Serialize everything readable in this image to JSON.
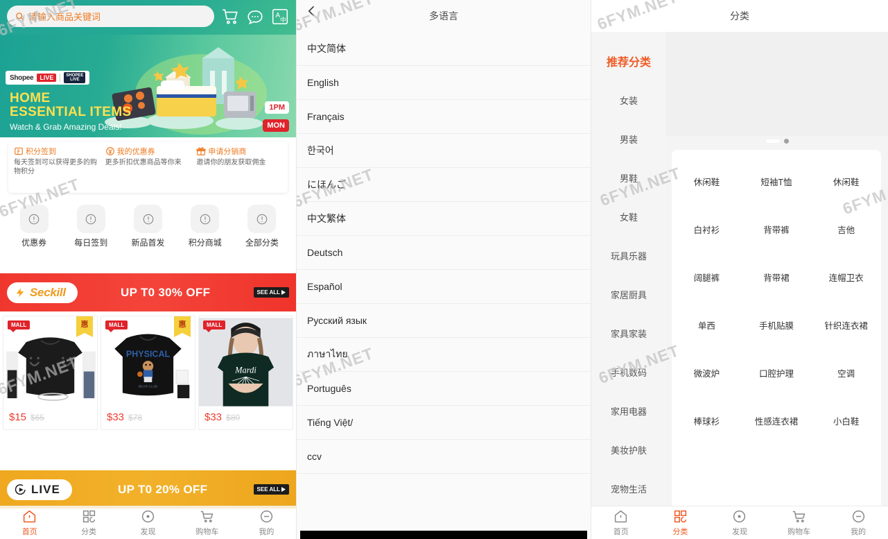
{
  "home": {
    "search": {
      "placeholder": "请输入商品关键词",
      "icon": "search-icon"
    },
    "header_icons": [
      "cart-icon",
      "chat-icon",
      "language-icon"
    ],
    "banner": {
      "brand": "Shopee",
      "brand_tag": "LIVE",
      "badge_line1": "SHOPEE",
      "badge_line2": "LIVE",
      "title_line1": "HOME",
      "title_line2": "ESSENTIAL ITEMS",
      "subtitle": "Watch & Grab Amazing Deals!",
      "time": "1PM",
      "day": "MON"
    },
    "promos": [
      {
        "icon": "points-icon",
        "title": "积分签到",
        "desc": "每天签到可以获得更多的购物积分"
      },
      {
        "icon": "coupon-icon",
        "title": "我的优惠券",
        "desc": "更多折扣优惠商品等你来"
      },
      {
        "icon": "gift-icon",
        "title": "申请分销商",
        "desc": "邀请你的朋友获取佣金"
      }
    ],
    "quick_links": [
      {
        "icon": "coupon-circle-icon",
        "label": "优惠券"
      },
      {
        "icon": "checkin-circle-icon",
        "label": "每日签到"
      },
      {
        "icon": "newitem-circle-icon",
        "label": "新品首发"
      },
      {
        "icon": "pointsmall-circle-icon",
        "label": "积分商城"
      },
      {
        "icon": "allcats-circle-icon",
        "label": "全部分类"
      }
    ],
    "seckill": {
      "icon": "lightning-icon",
      "label": "Seckill",
      "offer": "UP T0 30% OFF",
      "see_all": "SEE ALL"
    },
    "live": {
      "icon": "live-icon",
      "label": "LIVE",
      "offer": "UP T0 20% OFF",
      "see_all": "SEE ALL"
    },
    "products": [
      {
        "badge": "MALL",
        "hui": "惠",
        "price": "$15",
        "old_price": "$65",
        "alt": "black-smiley-sweatshirt"
      },
      {
        "badge": "MALL",
        "hui": "惠",
        "price": "$33",
        "old_price": "$78",
        "alt": "physical-bear-tee"
      },
      {
        "badge": "MALL",
        "hui": "",
        "price": "$33",
        "old_price": "$80",
        "alt": "mardi-graphic-tee-model"
      }
    ],
    "tabs": [
      {
        "icon": "home-icon",
        "label": "首页",
        "active": true
      },
      {
        "icon": "category-icon",
        "label": "分类",
        "active": false
      },
      {
        "icon": "discover-icon",
        "label": "发现",
        "active": false
      },
      {
        "icon": "cart-icon",
        "label": "购物车",
        "active": false
      },
      {
        "icon": "profile-icon",
        "label": "我的",
        "active": false
      }
    ]
  },
  "language": {
    "title": "多语言",
    "back_icon": "chevron-left-icon",
    "items": [
      "中文简体",
      "English",
      "Français",
      "한국어",
      "にほんご",
      "中文繁体",
      "Deutsch",
      "Español",
      "Русский язык",
      "ภาษาไทย",
      "Português",
      "Tiếng Việt/",
      "ccv"
    ]
  },
  "category": {
    "title": "分类",
    "sidebar": [
      {
        "label": "推荐分类",
        "active": true
      },
      {
        "label": "女装",
        "active": false
      },
      {
        "label": "男装",
        "active": false
      },
      {
        "label": "男鞋",
        "active": false
      },
      {
        "label": "女鞋",
        "active": false
      },
      {
        "label": "玩具乐器",
        "active": false
      },
      {
        "label": "家居厨具",
        "active": false
      },
      {
        "label": "家具家装",
        "active": false
      },
      {
        "label": "手机数码",
        "active": false
      },
      {
        "label": "家用电器",
        "active": false
      },
      {
        "label": "美妆护肤",
        "active": false
      },
      {
        "label": "宠物生活",
        "active": false
      }
    ],
    "carousel": {
      "pages": 2,
      "current": 2
    },
    "grid": [
      "休闲鞋",
      "短袖T恤",
      "休闲鞋",
      "白衬衫",
      "背带裤",
      "吉他",
      "阔腿裤",
      "背带裙",
      "连帽卫衣",
      "单西",
      "手机贴膜",
      "针织连衣裙",
      "微波炉",
      "口腔护理",
      "空调",
      "棒球衫",
      "性感连衣裙",
      "小白鞋"
    ],
    "tabs": [
      {
        "icon": "home-icon",
        "label": "首页",
        "active": false
      },
      {
        "icon": "category-icon",
        "label": "分类",
        "active": true
      },
      {
        "icon": "discover-icon",
        "label": "发现",
        "active": false
      },
      {
        "icon": "cart-icon",
        "label": "购物车",
        "active": false
      },
      {
        "icon": "profile-icon",
        "label": "我的",
        "active": false
      }
    ]
  },
  "watermark": {
    "text": "6FYM.NET"
  },
  "colors": {
    "brand_green": "#22a596",
    "accent_orange": "#ee7b22",
    "seckill_red": "#f0372e",
    "live_orange": "#efa81f",
    "price_red": "#ee3b2f",
    "tab_active": "#ee5a24"
  }
}
